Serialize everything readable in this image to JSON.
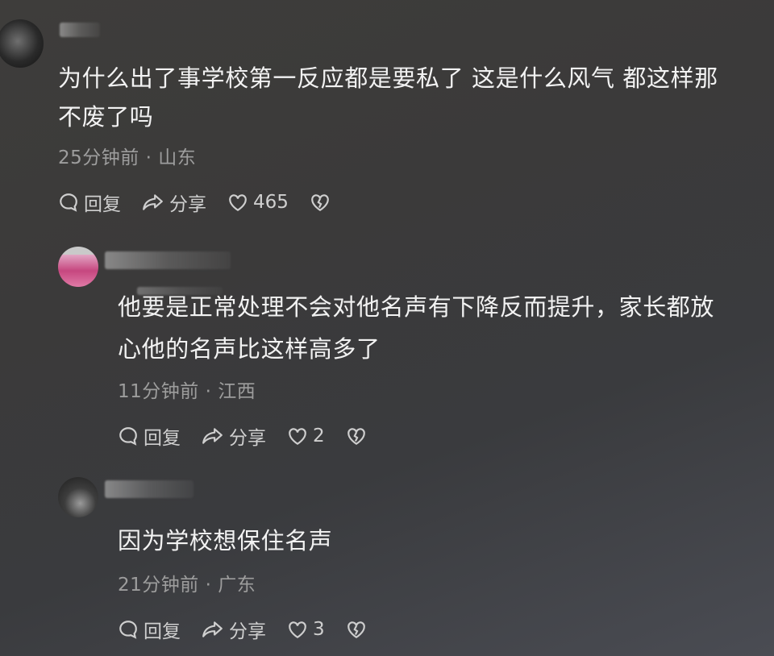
{
  "comments": [
    {
      "text_line1": "为什么出了事学校第一反应都是要私了 这是什么风气 都这样那",
      "text_line2": "不废了吗",
      "meta": "25分钟前 · 山东",
      "reply_label": "回复",
      "share_label": "分享",
      "like_count": "465"
    },
    {
      "text_line1": "他要是正常处理不会对他名声有下降反而提升，家长都放",
      "text_line2": "心他的名声比这样高多了",
      "meta": "11分钟前 · 江西",
      "reply_label": "回复",
      "share_label": "分享",
      "like_count": "2"
    },
    {
      "text_line1": "因为学校想保住名声",
      "meta": "21分钟前 · 广东",
      "reply_label": "回复",
      "share_label": "分享",
      "like_count": "3"
    }
  ],
  "icons": {
    "reply": "reply-bubble-icon",
    "share": "share-arrow-icon",
    "like": "heart-icon",
    "dislike": "broken-heart-icon"
  }
}
